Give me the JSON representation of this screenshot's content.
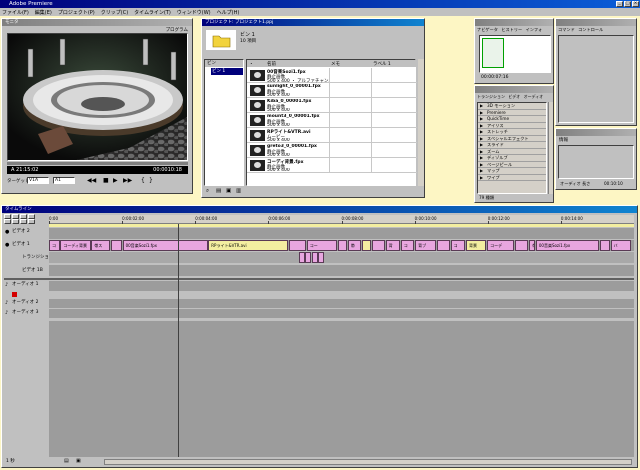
{
  "app": {
    "title": "Adobe Premiere"
  },
  "menu": [
    "ファイル(F)",
    "編集(E)",
    "プロジェクト(P)",
    "クリップ(C)",
    "タイムライン(T)",
    "ウィンドウ(W)",
    "ヘルプ(H)"
  ],
  "monitor": {
    "title": "モニタ",
    "tab": "プログラム",
    "timecode_left": "A 21:15:02",
    "timecode_right": "00:0010:18",
    "target_label": "ターゲット",
    "video_select": "V1A",
    "audio_select": "A1"
  },
  "project": {
    "title": "プロジェクト: プロジェクト1.ppj",
    "bin_name": "ビン 1",
    "bin_count": "10 項目",
    "bin_list_header": "ビン",
    "bin_list_item": "ビン 1",
    "columns": [
      "名前",
      "メモ",
      "ラベル 1"
    ],
    "items": [
      {
        "name": "00音楽Sozi1.fpx",
        "sub": "静止画像",
        "dim": "500 x 400 ・ アルファチャンネル"
      },
      {
        "name": "sunlight_0_00001.fpx",
        "sub": "静止画像",
        "dim": "500 x 400"
      },
      {
        "name": "Kiba_0_00001.fpx",
        "sub": "静止画像",
        "dim": "500 x 400"
      },
      {
        "name": "mount3_0_00001.fpx",
        "sub": "静止画像",
        "dim": "500 x 400"
      },
      {
        "name": "RPライト&VTR.avi",
        "sub": "ムービー",
        "dim": "500 x 400"
      },
      {
        "name": "greto3_0_00001.fpx",
        "sub": "静止画像",
        "dim": "500 x 400"
      },
      {
        "name": "コーディ背景.fpx",
        "sub": "静止画像",
        "dim": "500 x 400"
      }
    ]
  },
  "navigator": {
    "tabs": [
      "ナビゲータ",
      "ヒストリー",
      "インフォ"
    ],
    "timecode": "00:00:07:16"
  },
  "command": {
    "tabs": [
      "コマンド",
      "コントロール"
    ]
  },
  "transitions": {
    "tabs": [
      "トランジション",
      "ビデオ",
      "オーディオ"
    ],
    "items": [
      "3D モーション",
      "Premiere",
      "QuickTime",
      "アイリス",
      "ストレッチ",
      "スペシャルエフェクト",
      "スライド",
      "ズーム",
      "ディゾルブ",
      "ページピール",
      "マップ",
      "ワイプ"
    ],
    "footer": "79 種類"
  },
  "info": {
    "title": "情報",
    "label": "オーディオ 長さ",
    "value": "00:10:10"
  },
  "timeline": {
    "title": "タイムライン",
    "ruler": [
      "0:00",
      "0:00:02:00",
      "0:00:04:00",
      "0:00:06:00",
      "0:00:08:00",
      "0:00:10:00",
      "0:00:12:00",
      "0:00:14:00"
    ],
    "tracks": [
      "ビデオ 2",
      "ビデオ 1",
      "トランジション",
      "ビデオ 1B",
      "オーディオ 1",
      "オーディオ 2",
      "オーディオ 3"
    ],
    "clips_v1": [
      {
        "label": "コ",
        "x": 0.0,
        "w": 2.9
      },
      {
        "label": "コーディ背景",
        "x": 3.0,
        "w": 8.0
      },
      {
        "label": "帯ス",
        "x": 11.2,
        "w": 5.0
      },
      {
        "label": "",
        "x": 16.5,
        "w": 2.8
      },
      {
        "label": "00音楽Sozi1.fpx",
        "x": 19.5,
        "w": 22.5
      },
      {
        "label": "RPライト&VTR.avi",
        "x": 42.2,
        "w": 21.0
      },
      {
        "label": "",
        "x": 63.5,
        "w": 4.5
      },
      {
        "label": "コー",
        "x": 68.3,
        "w": 8.0
      },
      {
        "label": "",
        "x": 76.5,
        "w": 2.5
      },
      {
        "label": "帯",
        "x": 79.2,
        "w": 3.6
      },
      {
        "label": "",
        "x": 83.0,
        "w": 2.3
      },
      {
        "label": "",
        "x": 85.5,
        "w": 3.5
      },
      {
        "label": "背",
        "x": 89.2,
        "w": 3.8
      },
      {
        "label": "コ",
        "x": 93.2,
        "w": 3.5
      },
      {
        "label": "背ブ",
        "x": 97.0,
        "w": 5.5
      },
      {
        "label": "",
        "x": 102.7,
        "w": 3.5
      },
      {
        "label": "コ",
        "x": 106.4,
        "w": 3.7
      },
      {
        "label": "背景",
        "x": 110.5,
        "w": 5.4
      },
      {
        "label": "コーデ",
        "x": 116.1,
        "w": 7.0
      },
      {
        "label": "",
        "x": 123.4,
        "w": 3.6
      },
      {
        "label": "帯",
        "x": 127.2,
        "w": 1.5
      },
      {
        "label": "00音楽Sozi1.fpx",
        "x": 129.0,
        "w": 16.8
      },
      {
        "label": "",
        "x": 146.0,
        "w": 2.6
      },
      {
        "label": "バ",
        "x": 148.8,
        "w": 5.4
      }
    ],
    "clips_v1b": [
      {
        "label": "",
        "x": 66.2,
        "w": 1.6
      },
      {
        "label": "",
        "x": 67.9,
        "w": 1.6
      },
      {
        "label": "",
        "x": 69.6,
        "w": 1.6
      },
      {
        "label": "",
        "x": 71.3,
        "w": 1.6
      }
    ],
    "footer": "1 秒"
  },
  "colors": {
    "desktop": "#fdf6c4",
    "clip": "#e8a6df",
    "clip_alt": "#f3eea0",
    "window": "#c0c0c0",
    "title_active": "#00007b"
  },
  "icons": [
    "folder-icon",
    "play-icon",
    "stop-icon",
    "rewind-icon",
    "forward-icon",
    "trash-icon",
    "bin-icon",
    "arrow-right-icon",
    "lock-icon",
    "eye-icon",
    "speaker-icon"
  ]
}
